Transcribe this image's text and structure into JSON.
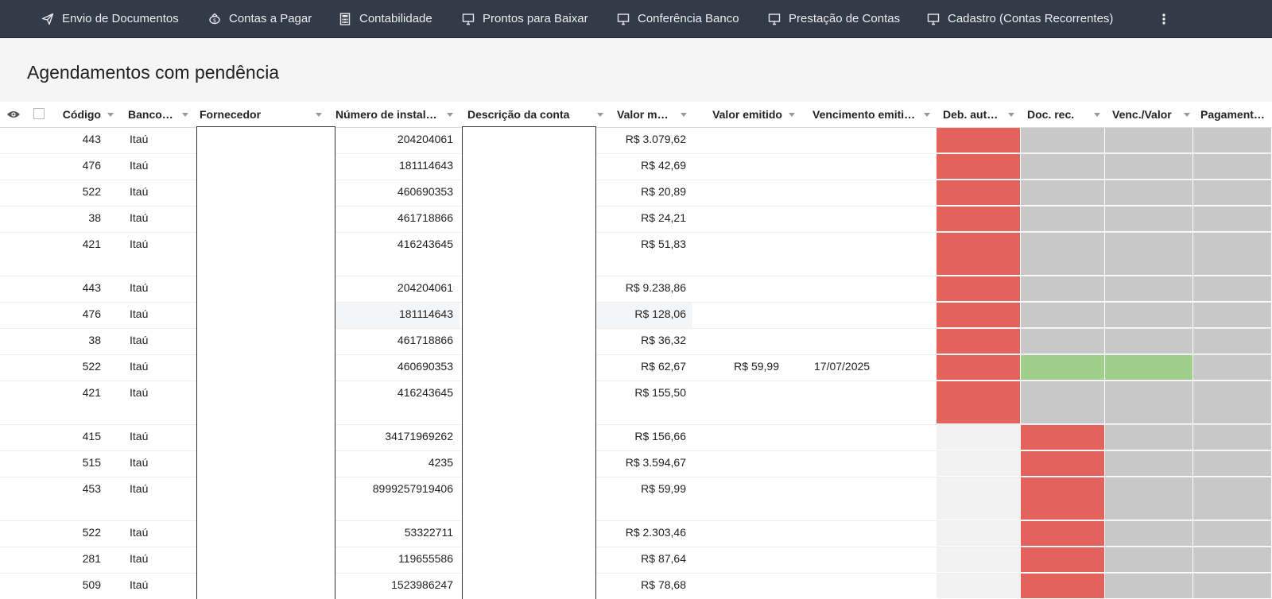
{
  "nav": {
    "items": [
      {
        "label": "Envio de Documentos",
        "icon": "send-icon"
      },
      {
        "label": "Contas a Pagar",
        "icon": "money-icon"
      },
      {
        "label": "Contabilidade",
        "icon": "calculator-icon"
      },
      {
        "label": "Prontos para Baixar",
        "icon": "desktop-icon"
      },
      {
        "label": "Conferência Banco",
        "icon": "desktop-icon"
      },
      {
        "label": "Prestação de Contas",
        "icon": "desktop-icon"
      },
      {
        "label": "Cadastro (Contas Recorrentes)",
        "icon": "desktop-icon"
      }
    ],
    "more_icon": "more-vertical-icon"
  },
  "page": {
    "title": "Agendamentos com pendência"
  },
  "table": {
    "columns": {
      "cod": "Código",
      "banco": "Banco da conta",
      "fornecedor": "Fornecedor",
      "num": "Número de instalação",
      "desc": "Descrição da conta",
      "valor": "Valor mensal",
      "valor_emi": "Valor emitido",
      "venc_emi": "Vencimento emitido",
      "deb": "Deb. automático",
      "doc": "Doc. rec.",
      "venc_val": "Venc./Valor",
      "pag": "Pagamento p"
    },
    "status_colors": {
      "red": "#e3625c",
      "gray": "#c8c8c8",
      "green": "#9fcf8b",
      "light": "#f2f2f2"
    },
    "rows": [
      {
        "cod": "443",
        "banco": "Itaú",
        "num": "204204061",
        "valor": "R$ 3.079,62",
        "valor_emi": "",
        "venc_emi": "",
        "deb": "red",
        "doc": "gray",
        "venc_val": "gray",
        "pag": "gray",
        "tall": false
      },
      {
        "cod": "476",
        "banco": "Itaú",
        "num": "181114643",
        "valor": "R$ 42,69",
        "valor_emi": "",
        "venc_emi": "",
        "deb": "red",
        "doc": "gray",
        "venc_val": "gray",
        "pag": "gray",
        "tall": false
      },
      {
        "cod": "522",
        "banco": "Itaú",
        "num": "460690353",
        "valor": "R$ 20,89",
        "valor_emi": "",
        "venc_emi": "",
        "deb": "red",
        "doc": "gray",
        "venc_val": "gray",
        "pag": "gray",
        "tall": false
      },
      {
        "cod": "38",
        "banco": "Itaú",
        "num": "461718866",
        "valor": "R$ 24,21",
        "valor_emi": "",
        "venc_emi": "",
        "deb": "red",
        "doc": "gray",
        "venc_val": "gray",
        "pag": "gray",
        "tall": false
      },
      {
        "cod": "421",
        "banco": "Itaú",
        "num": "416243645",
        "valor": "R$ 51,83",
        "valor_emi": "",
        "venc_emi": "",
        "deb": "red",
        "doc": "gray",
        "venc_val": "gray",
        "pag": "gray",
        "tall": true
      },
      {
        "cod": "443",
        "banco": "Itaú",
        "num": "204204061",
        "valor": "R$ 9.238,86",
        "valor_emi": "",
        "venc_emi": "",
        "deb": "red",
        "doc": "gray",
        "venc_val": "gray",
        "pag": "gray",
        "tall": false
      },
      {
        "cod": "476",
        "banco": "Itaú",
        "num": "181114643",
        "valor": "R$ 128,06",
        "valor_emi": "",
        "venc_emi": "",
        "deb": "red",
        "doc": "gray",
        "venc_val": "gray",
        "pag": "gray",
        "tall": false,
        "highlight": true
      },
      {
        "cod": "38",
        "banco": "Itaú",
        "num": "461718866",
        "valor": "R$ 36,32",
        "valor_emi": "",
        "venc_emi": "",
        "deb": "red",
        "doc": "gray",
        "venc_val": "gray",
        "pag": "gray",
        "tall": false
      },
      {
        "cod": "522",
        "banco": "Itaú",
        "num": "460690353",
        "valor": "R$ 62,67",
        "valor_emi": "R$ 59,99",
        "venc_emi": "17/07/2025",
        "deb": "red",
        "doc": "green",
        "venc_val": "green",
        "pag": "gray",
        "tall": false
      },
      {
        "cod": "421",
        "banco": "Itaú",
        "num": "416243645",
        "valor": "R$ 155,50",
        "valor_emi": "",
        "venc_emi": "",
        "deb": "red",
        "doc": "gray",
        "venc_val": "gray",
        "pag": "gray",
        "tall": true
      },
      {
        "cod": "415",
        "banco": "Itaú",
        "num": "34171969262",
        "valor": "R$ 156,66",
        "valor_emi": "",
        "venc_emi": "",
        "deb": "light",
        "doc": "red",
        "venc_val": "gray",
        "pag": "gray",
        "tall": false
      },
      {
        "cod": "515",
        "banco": "Itaú",
        "num": "4235",
        "valor": "R$ 3.594,67",
        "valor_emi": "",
        "venc_emi": "",
        "deb": "light",
        "doc": "red",
        "venc_val": "gray",
        "pag": "gray",
        "tall": false
      },
      {
        "cod": "453",
        "banco": "Itaú",
        "num": "8999257919406",
        "valor": "R$ 59,99",
        "valor_emi": "",
        "venc_emi": "",
        "deb": "light",
        "doc": "red",
        "venc_val": "gray",
        "pag": "gray",
        "tall": true
      },
      {
        "cod": "522",
        "banco": "Itaú",
        "num": "53322711",
        "valor": "R$ 2.303,46",
        "valor_emi": "",
        "venc_emi": "",
        "deb": "light",
        "doc": "red",
        "venc_val": "gray",
        "pag": "gray",
        "tall": false
      },
      {
        "cod": "281",
        "banco": "Itaú",
        "num": "119655586",
        "valor": "R$ 87,64",
        "valor_emi": "",
        "venc_emi": "",
        "deb": "light",
        "doc": "red",
        "venc_val": "gray",
        "pag": "gray",
        "tall": false
      },
      {
        "cod": "509",
        "banco": "Itaú",
        "num": "1523986247",
        "valor": "R$ 78,68",
        "valor_emi": "",
        "venc_emi": "",
        "deb": "light",
        "doc": "red",
        "venc_val": "gray",
        "pag": "gray",
        "tall": false
      }
    ]
  }
}
